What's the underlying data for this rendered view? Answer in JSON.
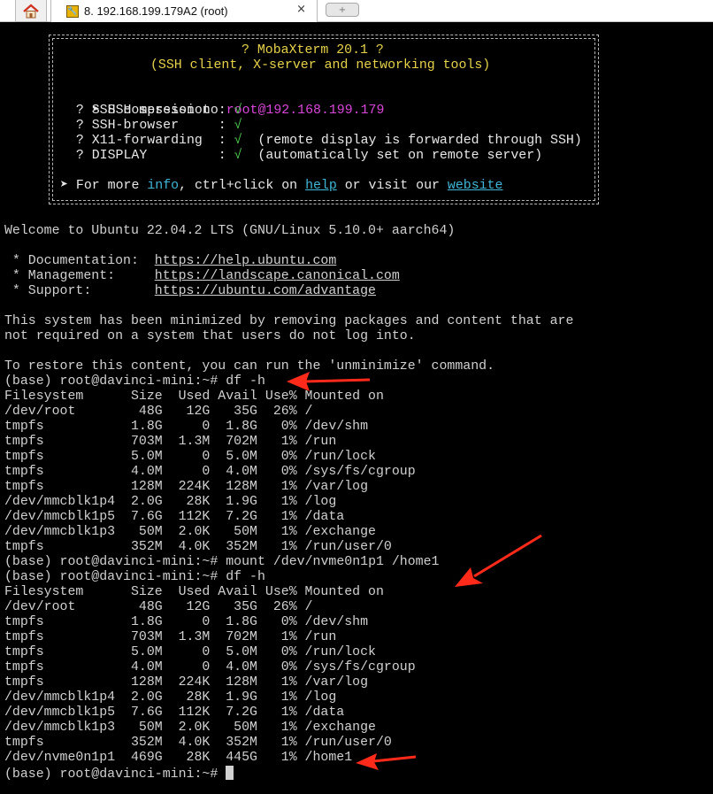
{
  "tabs": {
    "home_label": "",
    "session_title": "8. 192.168.199.179A2 (root)",
    "close_glyph": "×",
    "new_tab_glyph": "+"
  },
  "banner": {
    "title": "? MobaXterm 20.1 ?",
    "subtitle": "(SSH client, X-server and networking tools)",
    "ssh_prefix": "➤ SSH session to ",
    "ssh_user": "root",
    "ssh_host": "@192.168.199.179",
    "options": [
      {
        "label": "  ? SSH compression : ",
        "check": "√",
        "note": ""
      },
      {
        "label": "  ? SSH-browser     : ",
        "check": "√",
        "note": ""
      },
      {
        "label": "  ? X11-forwarding  : ",
        "check": "√",
        "note": "  (remote display is forwarded through SSH)"
      },
      {
        "label": "  ? DISPLAY         : ",
        "check": "√",
        "note": "  (automatically set on remote server)"
      }
    ],
    "more_prefix": "➤ For more ",
    "more_info": "info",
    "more_mid": ", ctrl+click on ",
    "more_help": "help",
    "more_or": " or visit our ",
    "more_website": "website"
  },
  "motd": {
    "welcome": "Welcome to Ubuntu 22.04.2 LTS (GNU/Linux 5.10.0+ aarch64)",
    "doc_label": " * Documentation:  ",
    "doc_url": "https://help.ubuntu.com",
    "mgmt_label": " * Management:     ",
    "mgmt_url": "https://landscape.canonical.com",
    "support_label": " * Support:        ",
    "support_url": "https://ubuntu.com/advantage",
    "minimized_1": "This system has been minimized by removing packages and content that are",
    "minimized_2": "not required on a system that users do not log into.",
    "restore": "To restore this content, you can run the 'unminimize' command."
  },
  "session": {
    "prompt": "(base) root@davinci-mini:~# ",
    "cmd1": "df -h",
    "cmd2": "mount /dev/nvme0n1p1 /home1",
    "cmd3": "df -h",
    "header": "Filesystem      Size  Used Avail Use% Mounted on",
    "df1": [
      "/dev/root        48G   12G   35G  26% /",
      "tmpfs           1.8G     0  1.8G   0% /dev/shm",
      "tmpfs           703M  1.3M  702M   1% /run",
      "tmpfs           5.0M     0  5.0M   0% /run/lock",
      "tmpfs           4.0M     0  4.0M   0% /sys/fs/cgroup",
      "tmpfs           128M  224K  128M   1% /var/log",
      "/dev/mmcblk1p4  2.0G   28K  1.9G   1% /log",
      "/dev/mmcblk1p5  7.6G  112K  7.2G   1% /data",
      "/dev/mmcblk1p3   50M  2.0K   50M   1% /exchange",
      "tmpfs           352M  4.0K  352M   1% /run/user/0"
    ],
    "df2": [
      "/dev/root        48G   12G   35G  26% /",
      "tmpfs           1.8G     0  1.8G   0% /dev/shm",
      "tmpfs           703M  1.3M  702M   1% /run",
      "tmpfs           5.0M     0  5.0M   0% /run/lock",
      "tmpfs           4.0M     0  4.0M   0% /sys/fs/cgroup",
      "tmpfs           128M  224K  128M   1% /var/log",
      "/dev/mmcblk1p4  2.0G   28K  1.9G   1% /log",
      "/dev/mmcblk1p5  7.6G  112K  7.2G   1% /data",
      "/dev/mmcblk1p3   50M  2.0K   50M   1% /exchange",
      "tmpfs           352M  4.0K  352M   1% /run/user/0",
      "/dev/nvme0n1p1  469G   28K  445G   1% /home1"
    ]
  },
  "colors": {
    "annotation_arrow": "#ff2a1a",
    "terminal_bg": "#000000",
    "terminal_fg": "#d0d0d0"
  }
}
